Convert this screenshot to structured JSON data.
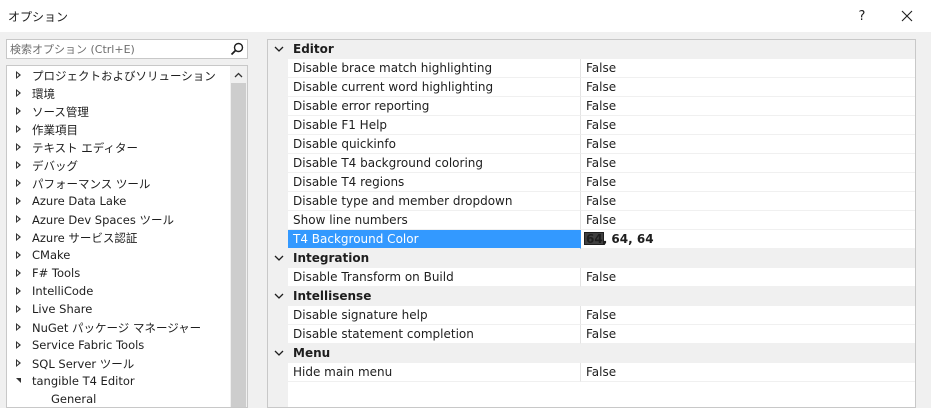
{
  "window": {
    "title": "オプション",
    "help_label": "?"
  },
  "search": {
    "placeholder": "検索オプション (Ctrl+E)"
  },
  "tree": {
    "items": [
      {
        "label": "プロジェクトおよびソリューション",
        "expanded": false
      },
      {
        "label": "環境",
        "expanded": false
      },
      {
        "label": "ソース管理",
        "expanded": false
      },
      {
        "label": "作業項目",
        "expanded": false
      },
      {
        "label": "テキスト エディター",
        "expanded": false
      },
      {
        "label": "デバッグ",
        "expanded": false
      },
      {
        "label": "パフォーマンス ツール",
        "expanded": false
      },
      {
        "label": "Azure Data Lake",
        "expanded": false
      },
      {
        "label": "Azure Dev Spaces ツール",
        "expanded": false
      },
      {
        "label": "Azure サービス認証",
        "expanded": false
      },
      {
        "label": "CMake",
        "expanded": false
      },
      {
        "label": "F# Tools",
        "expanded": false
      },
      {
        "label": "IntelliCode",
        "expanded": false
      },
      {
        "label": "Live Share",
        "expanded": false
      },
      {
        "label": "NuGet パッケージ マネージャー",
        "expanded": false
      },
      {
        "label": "Service Fabric Tools",
        "expanded": false
      },
      {
        "label": "SQL Server ツール",
        "expanded": false
      },
      {
        "label": "tangible T4 Editor",
        "expanded": true
      }
    ],
    "child": {
      "label": "General"
    }
  },
  "grid": {
    "categories": [
      {
        "name": "Editor",
        "rows": [
          {
            "name": "Disable brace match highlighting",
            "value": "False"
          },
          {
            "name": "Disable current word highlighting",
            "value": "False"
          },
          {
            "name": "Disable error reporting",
            "value": "False"
          },
          {
            "name": "Disable F1 Help",
            "value": "False"
          },
          {
            "name": "Disable quickinfo",
            "value": "False"
          },
          {
            "name": "Disable T4 background coloring",
            "value": "False"
          },
          {
            "name": "Disable T4 regions",
            "value": "False"
          },
          {
            "name": "Disable type and member dropdown",
            "value": "False"
          },
          {
            "name": "Show line numbers",
            "value": "False"
          }
        ],
        "color_row": {
          "name": "T4 Background Color",
          "value": "64, 64, 64",
          "swatch": "#404040"
        }
      },
      {
        "name": "Integration",
        "rows": [
          {
            "name": "Disable Transform on Build",
            "value": "False"
          }
        ]
      },
      {
        "name": "Intellisense",
        "rows": [
          {
            "name": "Disable signature help",
            "value": "False"
          },
          {
            "name": "Disable statement completion",
            "value": "False"
          }
        ]
      },
      {
        "name": "Menu",
        "rows": [
          {
            "name": "Hide main menu",
            "value": "False"
          }
        ]
      }
    ]
  },
  "colors": {
    "selection": "#3399ff",
    "panel_bg": "#f0f0f0"
  }
}
